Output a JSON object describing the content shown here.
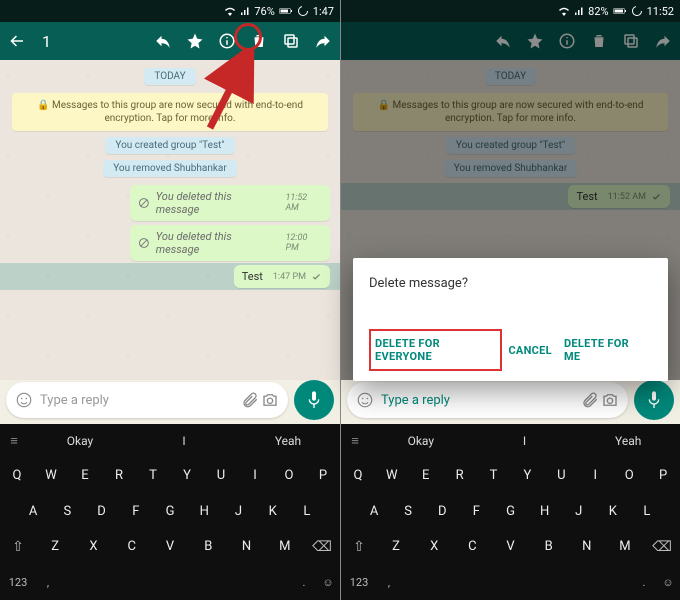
{
  "left": {
    "status": {
      "battery": "76%",
      "time": "1:47"
    },
    "appbar": {
      "count": "1"
    },
    "chat": {
      "day": "TODAY",
      "encryption": "🔒 Messages to this group are now secured with end-to-end encryption. Tap for more info.",
      "sys1": "You created group \"Test\"",
      "sys2": "You removed Shubhankar",
      "del1": "You deleted this message",
      "del1_ts": "11:52 AM",
      "del2": "You deleted this message",
      "del2_ts": "12:00 PM",
      "msg": "Test",
      "msg_ts": "1:47 PM"
    },
    "input": {
      "placeholder": "Type a reply"
    }
  },
  "right": {
    "status": {
      "battery": "82%",
      "time": "11:52"
    },
    "chat": {
      "day": "TODAY",
      "encryption": "🔒 Messages to this group are now secured with end-to-end encryption. Tap for more info.",
      "sys1": "You created group \"Test\"",
      "sys2": "You removed Shubhankar",
      "msg": "Test",
      "msg_ts": "11:52 AM"
    },
    "dialog": {
      "title": "Delete message?",
      "everyone": "DELETE FOR EVERYONE",
      "cancel": "CANCEL",
      "forme": "DELETE FOR ME"
    },
    "input": {
      "placeholder": "Type a reply"
    }
  },
  "keyboard": {
    "suggestions": [
      "Okay",
      "I",
      "Yeah"
    ],
    "row1": [
      "Q",
      "W",
      "E",
      "R",
      "T",
      "Y",
      "U",
      "I",
      "O",
      "P"
    ],
    "row2": [
      "A",
      "S",
      "D",
      "F",
      "G",
      "H",
      "J",
      "K",
      "L"
    ],
    "row3": [
      "Z",
      "X",
      "C",
      "V",
      "B",
      "N",
      "M"
    ],
    "numkey": "123"
  }
}
